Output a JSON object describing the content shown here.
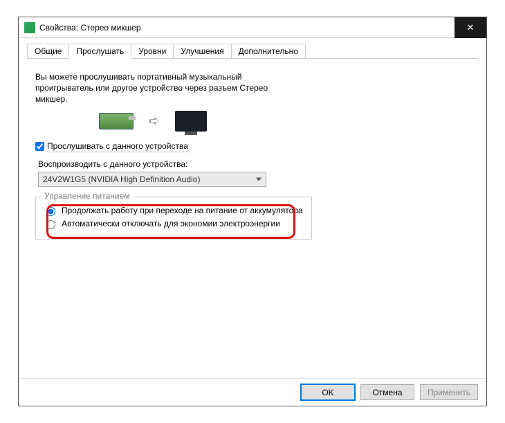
{
  "window": {
    "title": "Свойства: Стерео микшер"
  },
  "tabs": [
    {
      "label": "Общие"
    },
    {
      "label": "Прослушать"
    },
    {
      "label": "Уровни"
    },
    {
      "label": "Улучшения"
    },
    {
      "label": "Дополнительно"
    }
  ],
  "content": {
    "description": "Вы можете прослушивать портативный музыкальный проигрыватель или другое устройство через разъем Стерео микшер.",
    "listen_checkbox_label": "Прослушивать с данного устройства",
    "listen_checked": true,
    "device_label": "Воспроизводить с данного устройства:",
    "device_selected": "24V2W1G5 (NVIDIA High Definition Audio)",
    "power_group_title": "Управление питанием",
    "power_options": [
      {
        "label": "Продолжать работу при переходе на питание от аккумулятора",
        "checked": true
      },
      {
        "label": "Автоматически отключать для экономии электроэнергии",
        "checked": false
      }
    ]
  },
  "footer": {
    "ok": "OK",
    "cancel": "Отмена",
    "apply": "Применить"
  }
}
